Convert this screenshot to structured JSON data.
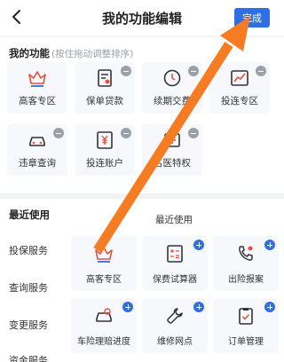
{
  "header": {
    "back_icon": "chevron-left-icon",
    "title": "我的功能编辑",
    "done_label": "完成",
    "accent": "#2f6fe4"
  },
  "my_functions": {
    "title": "我的功能",
    "hint": "(按住拖动调整排序)",
    "items": [
      {
        "label": "高客专区",
        "icon": "crown-icon"
      },
      {
        "label": "保单贷款",
        "icon": "loan-document-icon"
      },
      {
        "label": "续期交费",
        "icon": "renewal-clock-icon"
      },
      {
        "label": "投连专区",
        "icon": "trend-chart-icon"
      },
      {
        "label": "违章查询",
        "icon": "car-icon"
      },
      {
        "label": "投连账户",
        "icon": "yuan-account-icon"
      },
      {
        "label": "名医特权",
        "icon": "doctor-icon"
      }
    ]
  },
  "recent": {
    "title": "最近使用",
    "sub_title": "最近使用",
    "categories": [
      "投保服务",
      "查询服务",
      "变更服务",
      "资金服务"
    ],
    "items": [
      {
        "label": "高客专区",
        "icon": "crown-icon"
      },
      {
        "label": "保费试算器",
        "icon": "calculator-icon"
      },
      {
        "label": "出险报案",
        "icon": "phone-report-icon"
      },
      {
        "label": "车险理赔进度",
        "icon": "car-claim-icon"
      },
      {
        "label": "维修网点",
        "icon": "wrench-icon"
      },
      {
        "label": "订单管理",
        "icon": "clipboard-check-icon"
      }
    ]
  },
  "annotation": {
    "arrow_color": "#f57c22"
  }
}
